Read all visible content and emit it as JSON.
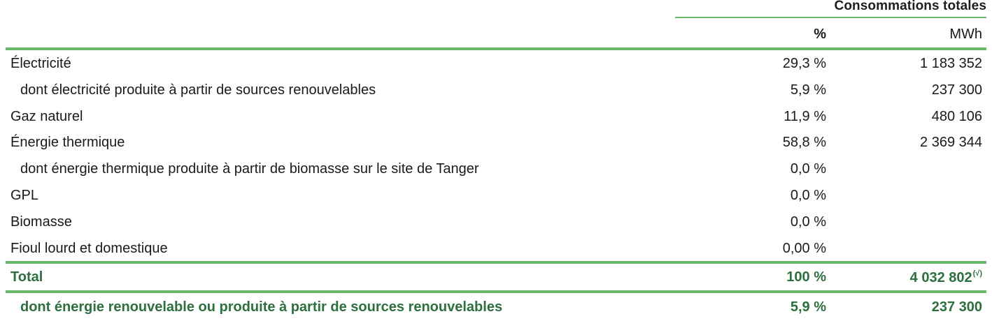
{
  "table": {
    "group_header": "Consommations totales",
    "columns": {
      "pct": "%",
      "mwh": "MWh"
    },
    "rows": [
      {
        "label": "Électricité",
        "pct": "29,3 %",
        "mwh": "1 183 352"
      },
      {
        "label": "dont électricité produite à partir de sources renouvelables",
        "pct": "5,9 %",
        "mwh": "237 300"
      },
      {
        "label": "Gaz naturel",
        "pct": "11,9 %",
        "mwh": "480 106"
      },
      {
        "label": "Énergie thermique",
        "pct": "58,8 %",
        "mwh": "2 369 344"
      },
      {
        "label": "dont énergie thermique produite à partir de biomasse sur le site de Tanger",
        "pct": "0,0 %",
        "mwh": ""
      },
      {
        "label": "GPL",
        "pct": "0,0 %",
        "mwh": ""
      },
      {
        "label": "Biomasse",
        "pct": "0,0 %",
        "mwh": ""
      },
      {
        "label": "Fioul lourd et domestique",
        "pct": "0,00 %",
        "mwh": ""
      }
    ],
    "total": {
      "label": "Total",
      "pct": "100 %",
      "mwh": "4 032 802",
      "mwh_note": "(√)"
    },
    "renewable": {
      "label": "dont énergie renouvelable ou produite à partir de sources renouvelables",
      "pct": "5,9 %",
      "mwh": "237 300"
    }
  },
  "colors": {
    "accent_line": "#6ab96a",
    "total_text": "#2e6f3f"
  }
}
